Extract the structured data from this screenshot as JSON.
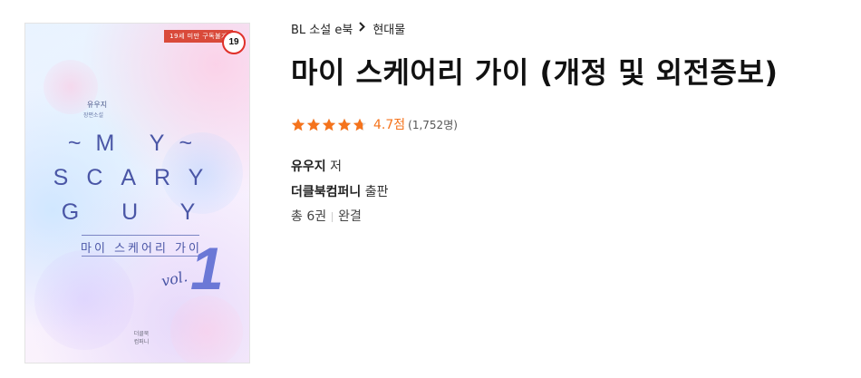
{
  "cover": {
    "age_label": "19세 미만 구독불가",
    "age_badge": "19",
    "author": "유우지",
    "genre": "장편소설",
    "title_en_line1": "~M Y~",
    "title_en_line2": "SCARY",
    "title_en_line3": "G U Y",
    "title_ko": "마이 스케어리 가이",
    "vol_text": "vol.",
    "vol_number": "1",
    "publisher": "더클북\n컴퍼니"
  },
  "breadcrumb": {
    "category": "BL 소설 e북",
    "subcategory": "현대물"
  },
  "title": "마이 스케어리 가이 (개정 및 외전증보)",
  "rating": {
    "stars": 4.7,
    "score_text": "4.7점",
    "count_text": "(1,752명)",
    "star_color": "#f5731c"
  },
  "author": {
    "name": "유우지",
    "suffix": "저"
  },
  "publisher": {
    "name": "더클북컴퍼니",
    "suffix": "출판"
  },
  "volumes": {
    "count_text": "총 6권",
    "status": "완결"
  }
}
